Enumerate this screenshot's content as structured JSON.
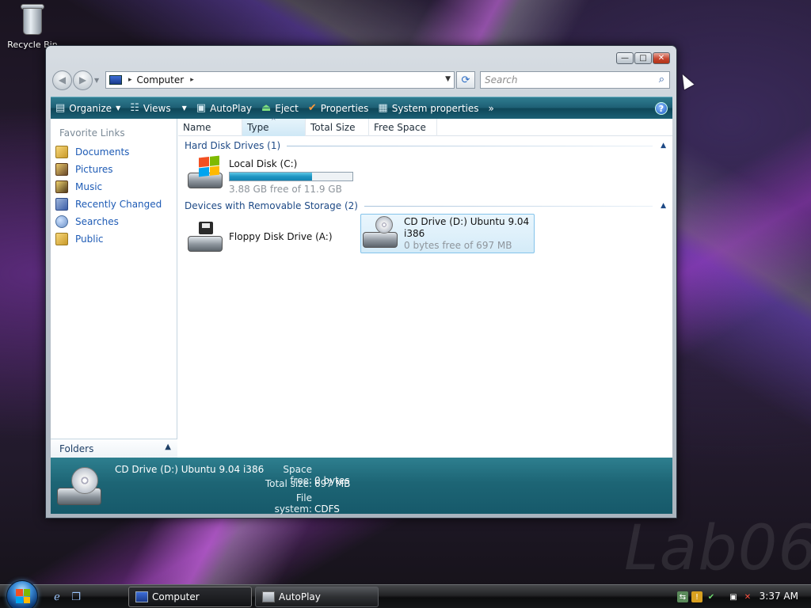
{
  "desktop": {
    "recycle_bin_label": "Recycle Bin",
    "watermark": "Lab06"
  },
  "window": {
    "caption_buttons": {
      "minimize": "—",
      "maximize": "□",
      "close": "✕"
    },
    "address": {
      "location": "Computer",
      "separator": "▸"
    },
    "search": {
      "placeholder": "Search"
    },
    "toolbar": {
      "organize": "Organize",
      "views": "Views",
      "autoplay": "AutoPlay",
      "eject": "Eject",
      "properties": "Properties",
      "system_properties": "System properties",
      "more": "»",
      "help": "?"
    }
  },
  "nav_pane": {
    "title": "Favorite Links",
    "links": [
      {
        "label": "Documents",
        "icon": "documents-icon"
      },
      {
        "label": "Pictures",
        "icon": "pictures-icon"
      },
      {
        "label": "Music",
        "icon": "music-icon"
      },
      {
        "label": "Recently Changed",
        "icon": "recently-changed-icon"
      },
      {
        "label": "Searches",
        "icon": "searches-icon"
      },
      {
        "label": "Public",
        "icon": "public-icon"
      }
    ],
    "folders_label": "Folders"
  },
  "columns": [
    "Name",
    "Type",
    "Total Size",
    "Free Space"
  ],
  "groups": {
    "hard_disk": {
      "title": "Hard Disk Drives (1)",
      "drives": [
        {
          "name": "Local Disk (C:)",
          "free": "3.88 GB free of 11.9 GB",
          "used_fraction": 0.67
        }
      ]
    },
    "removable": {
      "title": "Devices with Removable Storage (2)",
      "drives": [
        {
          "name": "Floppy Disk Drive (A:)"
        },
        {
          "name_line1": "CD Drive (D:) Ubuntu 9.04",
          "name_line2": "i386",
          "free": "0 bytes free of 697 MB"
        }
      ]
    }
  },
  "details": {
    "title": "CD Drive (D:) Ubuntu 9.04 i386",
    "space_free_label": "Space free:",
    "space_free": "0 bytes",
    "total_size_label": "Total size:",
    "total_size": "697 MB",
    "file_system_label": "File system:",
    "file_system": "CDFS"
  },
  "taskbar": {
    "tasks": [
      "Computer",
      "AutoPlay"
    ],
    "clock": "3:37 AM"
  },
  "colors": {
    "toolbar": "#1e5f74",
    "link": "#1e5bb5",
    "progress": "#1f95c2"
  }
}
